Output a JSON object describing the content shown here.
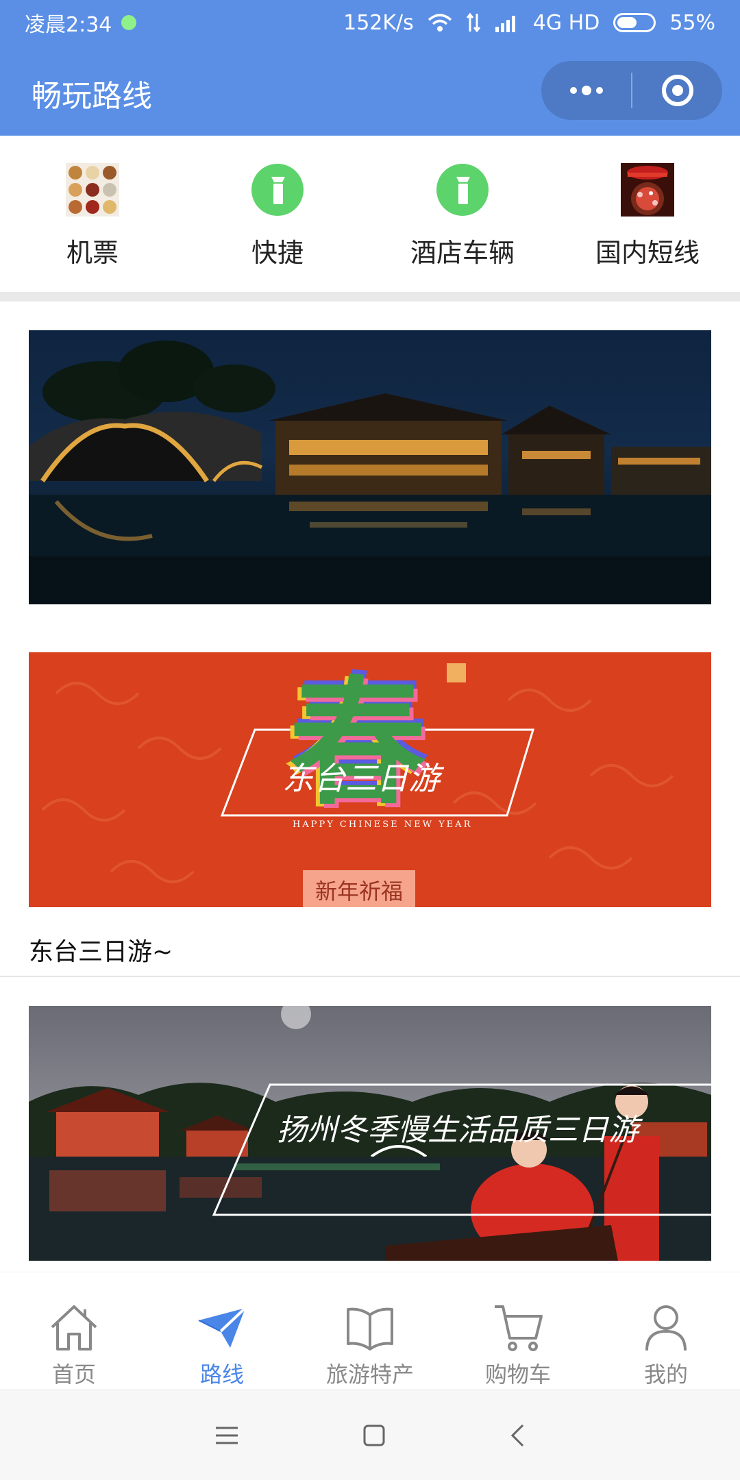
{
  "status_bar": {
    "time": "凌晨2:34",
    "speed": "152K/s",
    "network": "4G HD",
    "battery": "55%",
    "battery_level": 0.55
  },
  "navbar": {
    "title": "畅玩路线"
  },
  "categories": [
    {
      "label": "机票",
      "icon": "food-thumbnail-icon"
    },
    {
      "label": "快捷",
      "icon": "spray-bottle-icon"
    },
    {
      "label": "酒店车辆",
      "icon": "spray-bottle-icon"
    },
    {
      "label": "国内短线",
      "icon": "lantern-thumbnail-icon"
    }
  ],
  "cards": [
    {
      "caption": "",
      "overlay": ""
    },
    {
      "caption": "东台三日游~",
      "overlay": "东台三日游",
      "sub_text": "HAPPY CHINESE NEW YEAR",
      "badge": "新年祈福",
      "glyph": "春"
    },
    {
      "caption": "",
      "overlay": "扬州冬季慢生活品质三日游"
    }
  ],
  "tabbar": {
    "items": [
      {
        "label": "首页",
        "icon": "home-icon",
        "active": false
      },
      {
        "label": "路线",
        "icon": "paper-plane-icon",
        "active": true
      },
      {
        "label": "旅游特产",
        "icon": "book-icon",
        "active": false
      },
      {
        "label": "购物车",
        "icon": "cart-icon",
        "active": false
      },
      {
        "label": "我的",
        "icon": "user-icon",
        "active": false
      }
    ]
  },
  "colors": {
    "brand": "#5b8fe6",
    "tab_active": "#4a86e8",
    "tab_inactive": "#888888",
    "spray_icon": "#5cd36b"
  }
}
